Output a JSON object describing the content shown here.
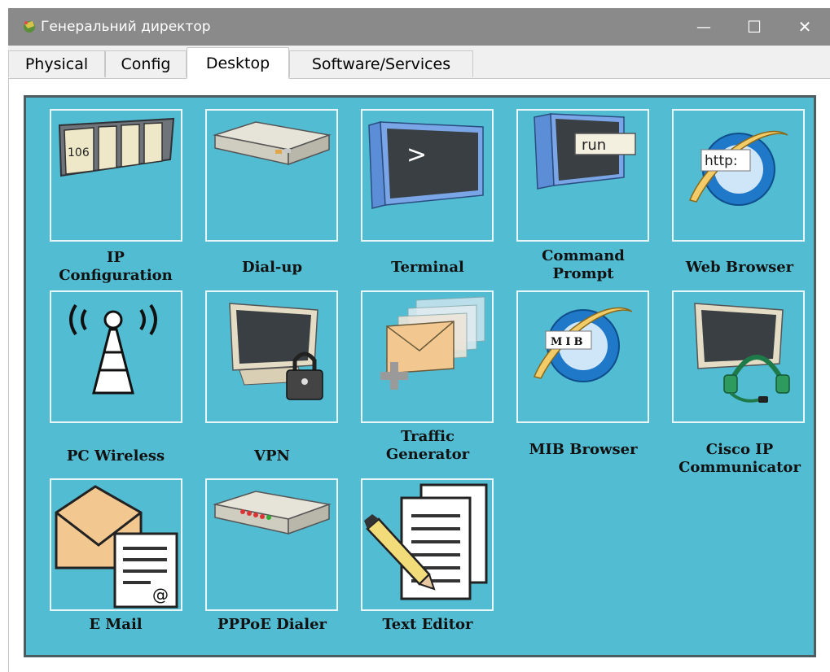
{
  "window": {
    "title": "Генеральний директор",
    "minimize": "—",
    "maximize": "☐",
    "close": "✕"
  },
  "tabs": [
    "Physical",
    "Config",
    "Desktop",
    "Software/Services"
  ],
  "active_tab": "Desktop",
  "apps": [
    {
      "line1": "IP",
      "line2": "Configuration",
      "icon": "ip-config-icon",
      "badge": "106"
    },
    {
      "line1": "Dial-up",
      "line2": "",
      "icon": "modem-icon"
    },
    {
      "line1": "Terminal",
      "line2": "",
      "icon": "terminal-icon",
      "badge": ">"
    },
    {
      "line1": "Command",
      "line2": "Prompt",
      "icon": "command-prompt-icon",
      "badge": "run"
    },
    {
      "line1": "Web Browser",
      "line2": "",
      "icon": "web-browser-icon",
      "badge": "http:"
    },
    {
      "line1": "PC Wireless",
      "line2": "",
      "icon": "wireless-tower-icon"
    },
    {
      "line1": "VPN",
      "line2": "",
      "icon": "vpn-lock-icon"
    },
    {
      "line1": "Traffic",
      "line2": "Generator",
      "icon": "traffic-generator-icon"
    },
    {
      "line1": "MIB Browser",
      "line2": "",
      "icon": "mib-browser-icon",
      "badge": "MIB"
    },
    {
      "line1": "Cisco IP",
      "line2": "Communicator",
      "icon": "headset-icon"
    },
    {
      "line1": "E Mail",
      "line2": "",
      "icon": "email-icon",
      "badge": "@"
    },
    {
      "line1": "PPPoE Dialer",
      "line2": "",
      "icon": "pppoe-dialer-icon"
    },
    {
      "line1": "Text Editor",
      "line2": "",
      "icon": "text-editor-icon"
    }
  ]
}
